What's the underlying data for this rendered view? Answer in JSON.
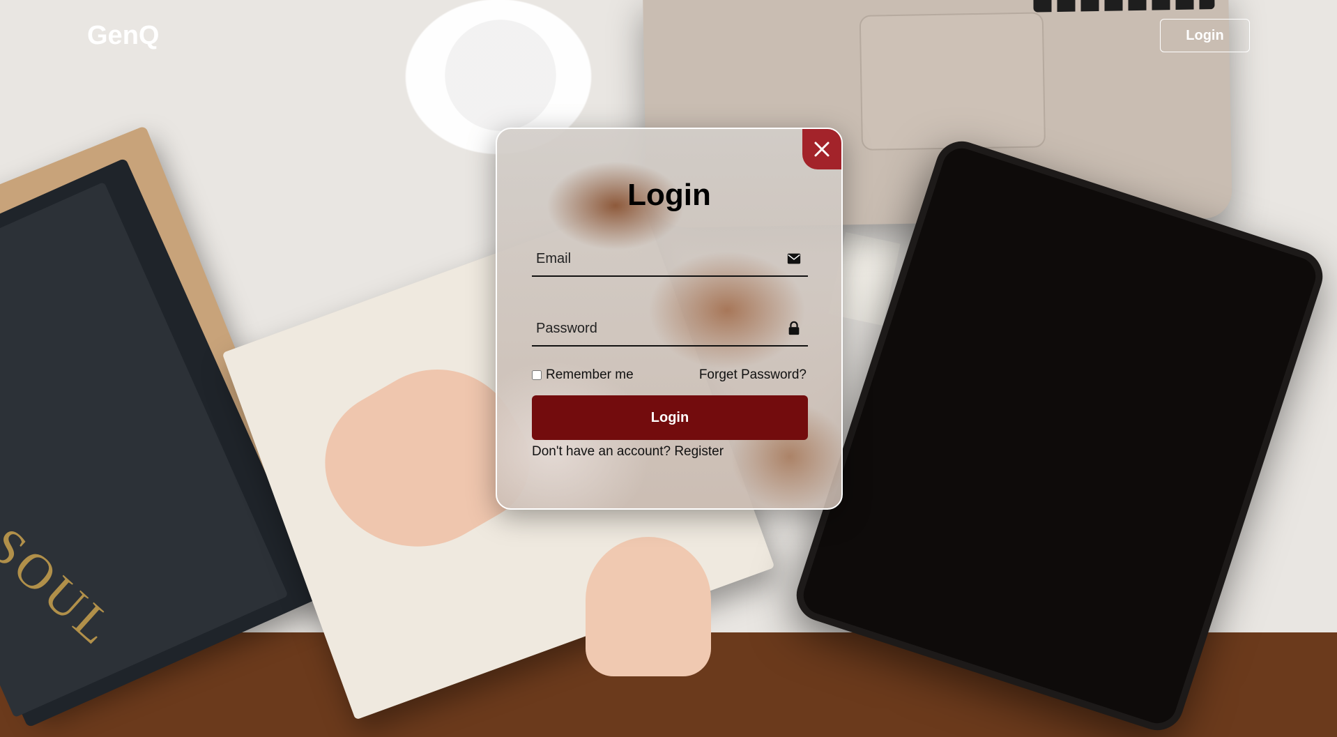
{
  "header": {
    "logo": "GenQ",
    "login_label": "Login"
  },
  "modal": {
    "title": "Login",
    "close_icon": "close-icon",
    "email_placeholder": "Email",
    "email_icon": "envelope-icon",
    "password_placeholder": "Password",
    "password_icon": "lock-icon",
    "remember_label": "Remember me",
    "forgot_label": "Forget Password?",
    "submit_label": "Login",
    "register_prompt": "Don't have an account?",
    "register_link": "Register"
  },
  "colors": {
    "close_bg": "#a3232a",
    "submit_bg": "#730c0d",
    "text_white": "#ffffff"
  }
}
